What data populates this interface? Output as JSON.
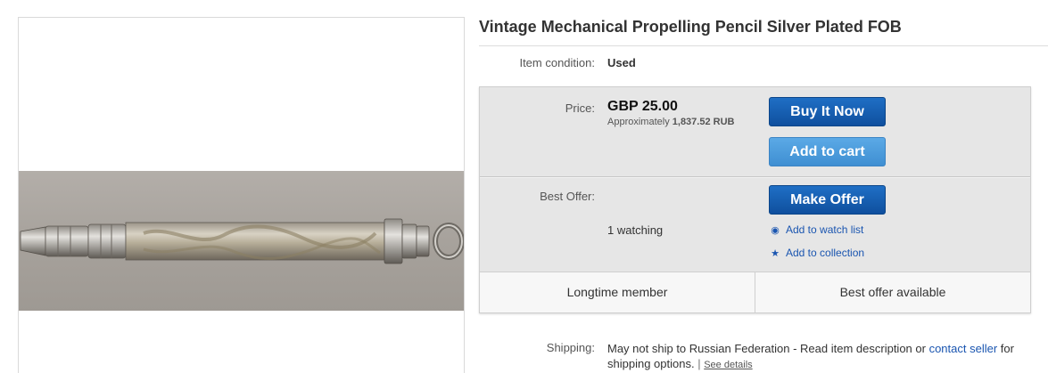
{
  "listing": {
    "title": "Vintage Mechanical Propelling Pencil Silver Plated FOB",
    "condition_label": "Item condition:",
    "condition_value": "Used"
  },
  "price": {
    "label": "Price:",
    "value": "GBP 25.00",
    "approx_prefix": "Approximately",
    "approx_value": "1,837.52 RUB"
  },
  "buttons": {
    "buy_now": "Buy It Now",
    "add_to_cart": "Add to cart",
    "make_offer": "Make Offer"
  },
  "offer": {
    "label": "Best Offer:",
    "watching": "1 watching"
  },
  "links": {
    "watch_list": "Add to watch list",
    "collection": "Add to collection",
    "watch_icon": "eye-icon",
    "collection_icon": "star-icon"
  },
  "badges": {
    "left": "Longtime member",
    "right": "Best offer available"
  },
  "shipping": {
    "label": "Shipping:",
    "text_before": "May not ship to Russian Federation - Read item description or",
    "contact_link": "contact seller",
    "text_after": "for shipping options.",
    "separator": "|",
    "details_link": "See details"
  },
  "colors": {
    "primary_button": "#1a5fb4",
    "secondary_button": "#4a9bdc",
    "link": "#1a55b0",
    "buy_box_bg": "#e6e6e6"
  }
}
